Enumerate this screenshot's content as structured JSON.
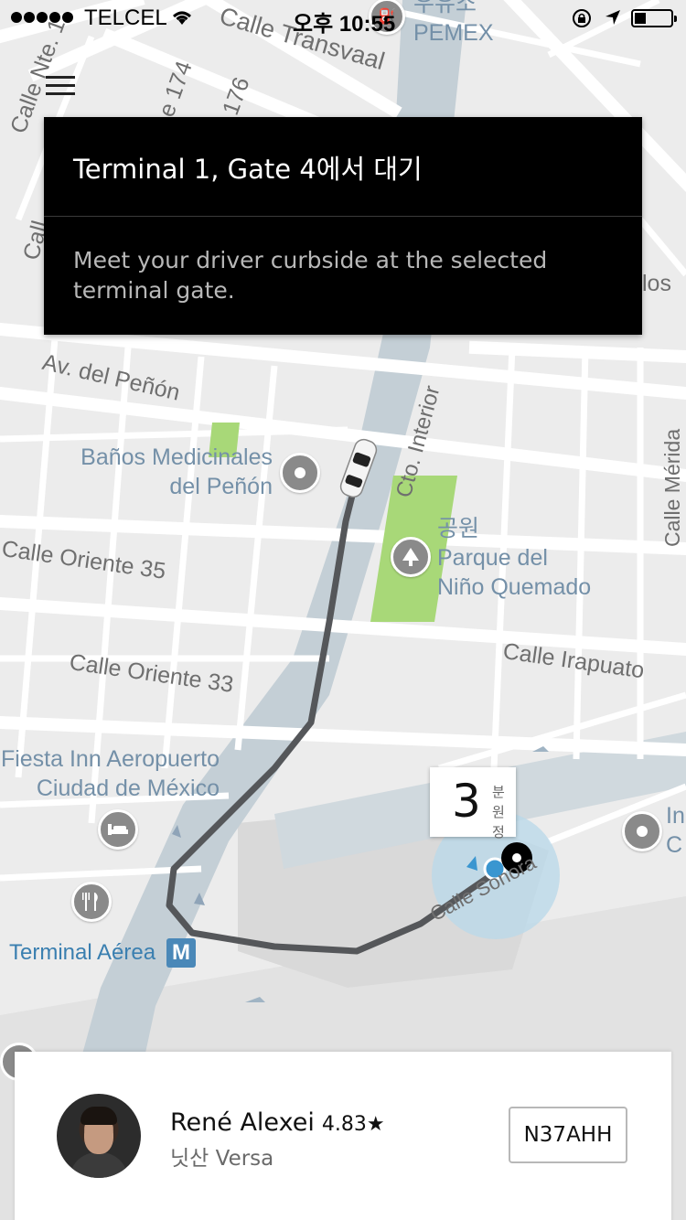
{
  "status_bar": {
    "carrier": "TELCEL",
    "time": "오후 10:55"
  },
  "menu": {
    "icon": "hamburger-menu-icon"
  },
  "info_card": {
    "title": "Terminal 1, Gate 4에서 대기",
    "body": "Meet your driver curbside at the selected terminal gate."
  },
  "map": {
    "street_labels": [
      "Calle Transvaal",
      "Calle Nte. 1",
      "e 174",
      "176",
      "Call",
      "Av. del Peñón",
      "Cto. Interior",
      "Calle Oriente 35",
      "Calle Oriente 33",
      "Calle Irapuato",
      "Calle Mérida",
      "Calle Sonora",
      "los",
      "C"
    ],
    "poi_labels": {
      "gas_station": [
        "우유소",
        "PEMEX"
      ],
      "banos": [
        "Baños Medicinales",
        "del Peñón"
      ],
      "park": [
        "공원",
        "Parque del",
        "Niño Quemado"
      ],
      "hotel": [
        "Fiesta Inn Aeropuerto",
        "Ciudad de México"
      ],
      "terminal": "Terminal Aérea",
      "right_edge": [
        "In",
        "C"
      ]
    },
    "metro_letter": "M",
    "colors": {
      "route": "#55575a",
      "park": "#a8d878",
      "poi_text": "#7490a8",
      "pickup_halo": "#b8d8ea",
      "user_dot": "#3a96d0"
    }
  },
  "eta": {
    "number": "3",
    "unit_line1": "분",
    "unit_line2": "원정"
  },
  "driver": {
    "name": "René Alexei",
    "rating": "4.83★",
    "car": "닛산 Versa",
    "plate": "N37AHH"
  }
}
